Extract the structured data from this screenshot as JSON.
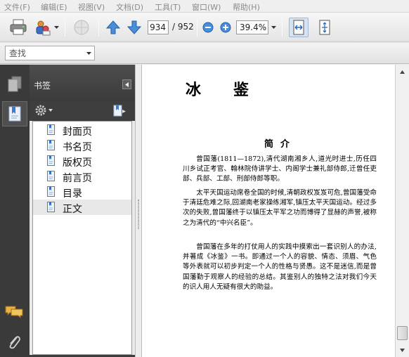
{
  "menu": {
    "items": [
      "文件(F)",
      "编辑(E)",
      "视图(V)",
      "文档(D)",
      "工具(T)",
      "窗口(W)",
      "帮助(H)"
    ]
  },
  "toolbar": {
    "page_current": "934",
    "page_total": "/ 952",
    "zoom_value": "39.4%"
  },
  "search": {
    "placeholder": "查找"
  },
  "sidebar": {
    "panel_title": "书签",
    "bookmarks": [
      "封面页",
      "书名页",
      "版权页",
      "前言页",
      "目录",
      "正文"
    ],
    "selected": "正文"
  },
  "document": {
    "book_title": "冰鉴",
    "section_title": "简介",
    "paragraphs": [
      "曾国藩(1811—1872),清代湖南湘乡人,道光时进士,历任四川乡试正考官、翰林院侍讲学士、内阁学士兼礼部侍郎,迁曾任吏部、兵部、工部、刑部侍郎等职。",
      "太平天国运动席卷全国的时候,清朝政权岌岌可危,曾国藩受命于清廷危难之际,回湖南老家操练湘军,镇压太平天国运动。经过多次的失败,曾国藩终于以镇压太平军之功而博得了显赫的声誉,被称之为清代的“中兴名臣”。",
      "曾国藩在多年的打仗用人的实践中摸索出一套识别人的办法,并著成《冰鉴》一书。即通过一个人的容貌、情态、须眉、气色等外表就可以初步判定一个人的性格与贤愚。这不是迷信,而是曾国藩勤于观察人的经验的总结。其鉴别人的独特之法对我们今天的识人用人无疑有很大的助益。"
    ]
  }
}
